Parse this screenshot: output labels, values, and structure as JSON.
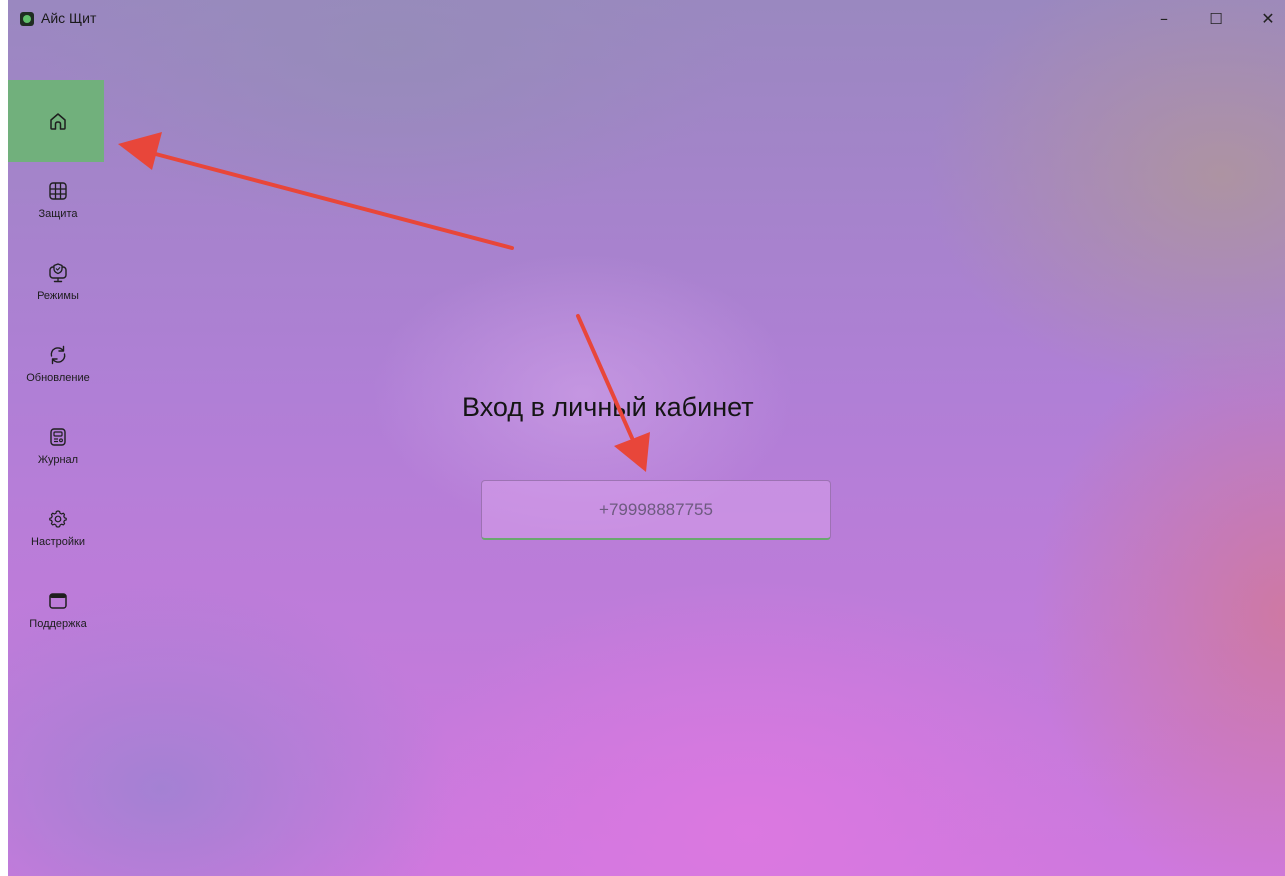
{
  "window": {
    "title": "Айс Щит",
    "controls": {
      "minimize": "–",
      "maximize": "☐",
      "close": "✕"
    }
  },
  "sidebar": {
    "items": [
      {
        "id": "home",
        "label": "",
        "icon": "home-icon",
        "active": true
      },
      {
        "id": "protection",
        "label": "Защита",
        "icon": "grid-icon"
      },
      {
        "id": "modes",
        "label": "Режимы",
        "icon": "monitor-shield-icon"
      },
      {
        "id": "update",
        "label": "Обновление",
        "icon": "refresh-icon"
      },
      {
        "id": "journal",
        "label": "Журнал",
        "icon": "journal-icon"
      },
      {
        "id": "settings",
        "label": "Настройки",
        "icon": "gear-icon"
      },
      {
        "id": "support",
        "label": "Поддержка",
        "icon": "window-icon"
      }
    ]
  },
  "main": {
    "title": "Вход в личный кабинет",
    "phone_input": {
      "placeholder": "+79998887755",
      "value": ""
    }
  },
  "colors": {
    "accent": "#71b07c",
    "annotation_arrow": "#e8463a"
  }
}
